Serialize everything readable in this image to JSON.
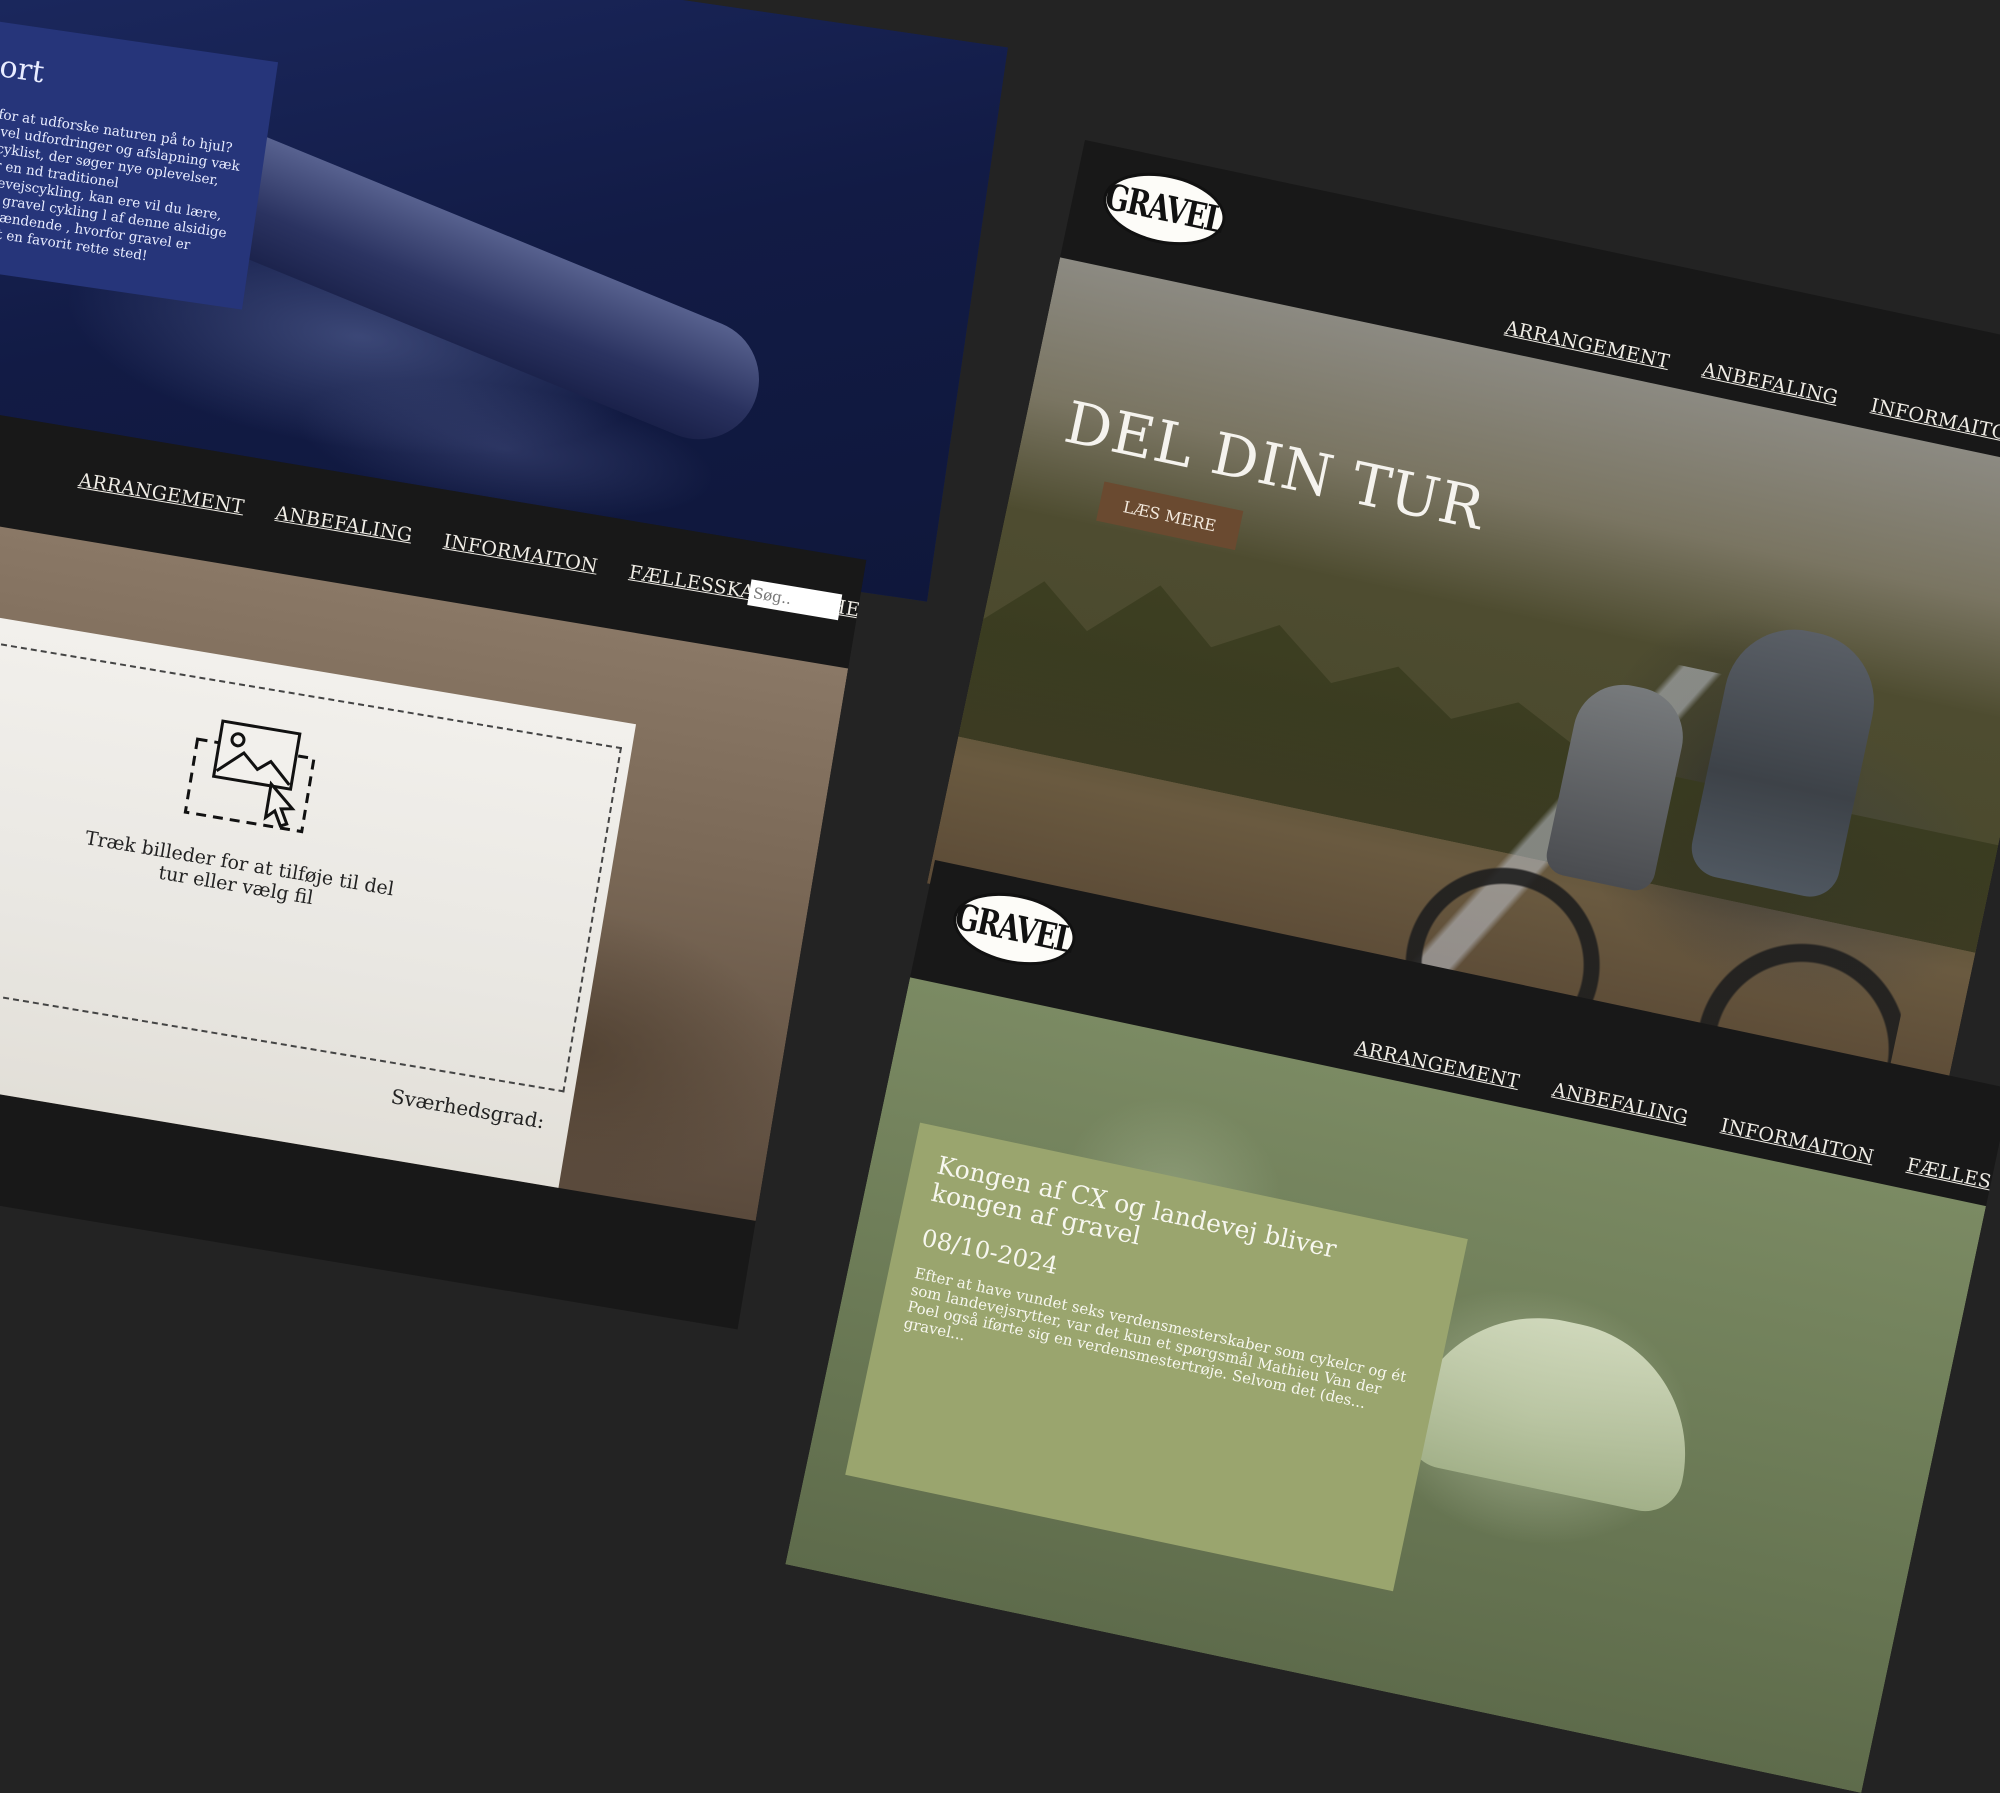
{
  "nav": {
    "items": [
      "ARRANGEMENT",
      "ANBEFALING",
      "INFORMAITON",
      "FÆLLESSKAB",
      "NYHEDER*"
    ]
  },
  "brand": {
    "logo_text": "GRAVEL"
  },
  "blue_panel": {
    "title": "sort",
    "body": "en for at udforske naturen på to hjul? Gravel udfordringer og afslapning væk fra cyklist, der søger nye oplevelser, eller en nd traditionel landevejscykling, kan ere vil du lære, hvad gravel cykling l af denne alsidige og spændende , hvorfor gravel er blevet en favorit rette sted!"
  },
  "upload_panel": {
    "search_placeholder": "Søg..",
    "drop_text": "Træk billeder for at tilføje til del tur eller vælg fil",
    "difficulty_label": "Sværhedsgrad:"
  },
  "hero_panel": {
    "headline": "DEL DIN TUR",
    "cta": "LÆS MERE"
  },
  "news_panel": {
    "title": "Kongen af CX og landevej bliver kongen af gravel",
    "date": "08/10-2024",
    "body": "Efter at have vundet seks verdensmesterskaber som cykelcr og ét som landevejsrytter, var det kun et spørgsmål Mathieu Van der Poel også iførte sig en verdensmestertrøje. Selvom det (des... gravel..."
  },
  "colors": {
    "background": "#232323",
    "blue_card": "#26357a",
    "cta": "#6a4a30",
    "news_card": "#9aa56e"
  }
}
